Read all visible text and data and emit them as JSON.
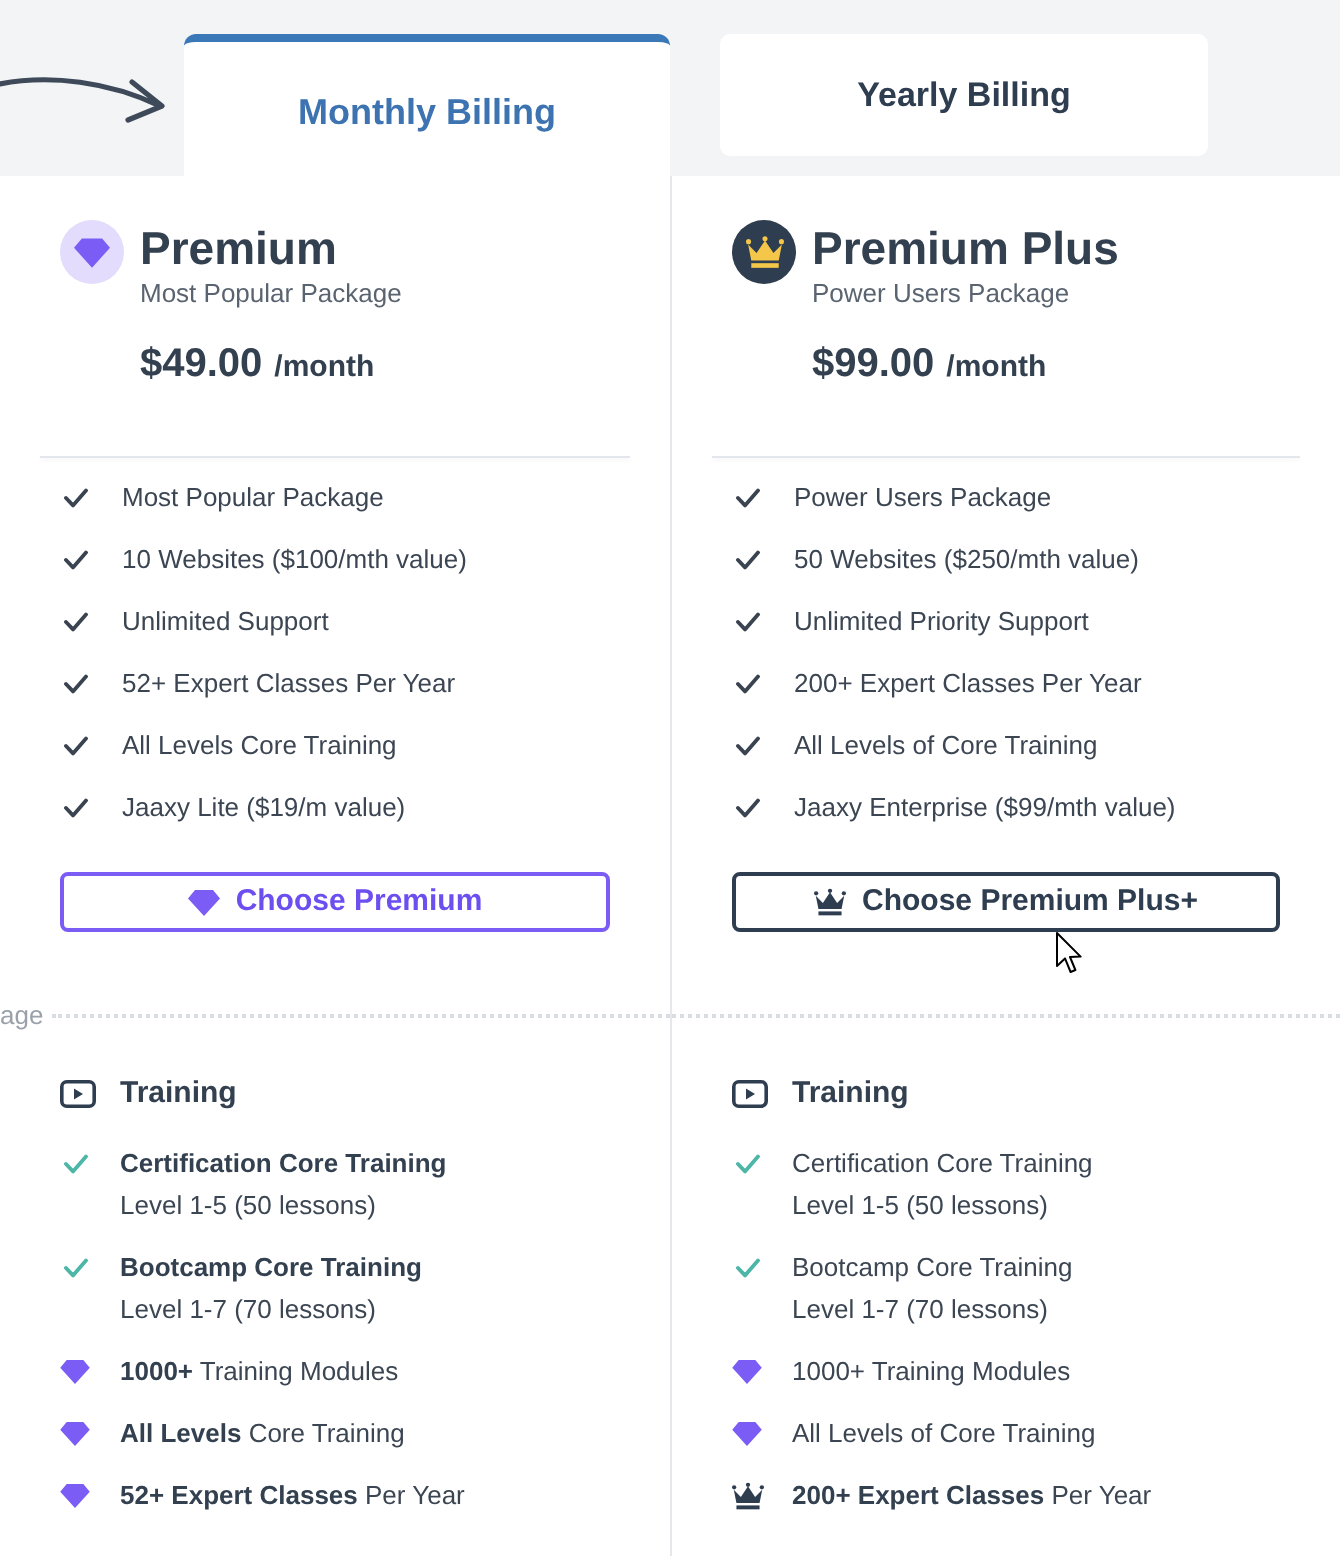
{
  "tabs": [
    {
      "label": "Monthly Billing",
      "selected": true
    },
    {
      "label": "Yearly Billing",
      "selected": false
    }
  ],
  "plans": [
    {
      "kind": "diamond",
      "name": "Premium",
      "tagline": "Most Popular Package",
      "price": "$49.00",
      "period": "/month",
      "features": [
        "Most Popular Package",
        "10 Websites ($100/mth value)",
        "Unlimited Support",
        "52+ Expert Classes Per Year",
        "All Levels Core Training",
        "Jaaxy Lite ($19/m value)"
      ],
      "button": "Choose Premium",
      "divider_label": "age",
      "training": {
        "title": "Training",
        "items": [
          {
            "kind": "check",
            "text": "**Certification Core Training**",
            "detail": "Level 1-5 (50 lessons)"
          },
          {
            "kind": "check",
            "text": "**Bootcamp Core Training**",
            "detail": "Level 1-7 (70 lessons)"
          },
          {
            "kind": "diamond",
            "text": "**1000+** Training Modules"
          },
          {
            "kind": "diamond",
            "text": "**All Levels** Core Training"
          },
          {
            "kind": "diamond",
            "text": "**52+ Expert Classes** Per Year"
          }
        ]
      }
    },
    {
      "kind": "crown",
      "name": "Premium Plus",
      "tagline": "Power Users Package",
      "price": "$99.00",
      "period": "/month",
      "features": [
        "Power Users Package",
        "50 Websites ($250/mth value)",
        "Unlimited Priority Support",
        "200+ Expert Classes Per Year",
        "All Levels of Core Training",
        "Jaaxy Enterprise ($99/mth value)"
      ],
      "button": "Choose Premium Plus+",
      "training": {
        "title": "Training",
        "items": [
          {
            "kind": "check",
            "text": "Certification Core Training",
            "detail": "Level 1-5 (50 lessons)"
          },
          {
            "kind": "check",
            "text": "Bootcamp Core Training",
            "detail": "Level 1-7 (70 lessons)"
          },
          {
            "kind": "diamond",
            "text": "1000+ Training Modules"
          },
          {
            "kind": "diamond",
            "text": "All Levels of Core Training"
          },
          {
            "kind": "crown",
            "text": "**200+ Expert Classes** Per Year"
          }
        ]
      }
    }
  ]
}
